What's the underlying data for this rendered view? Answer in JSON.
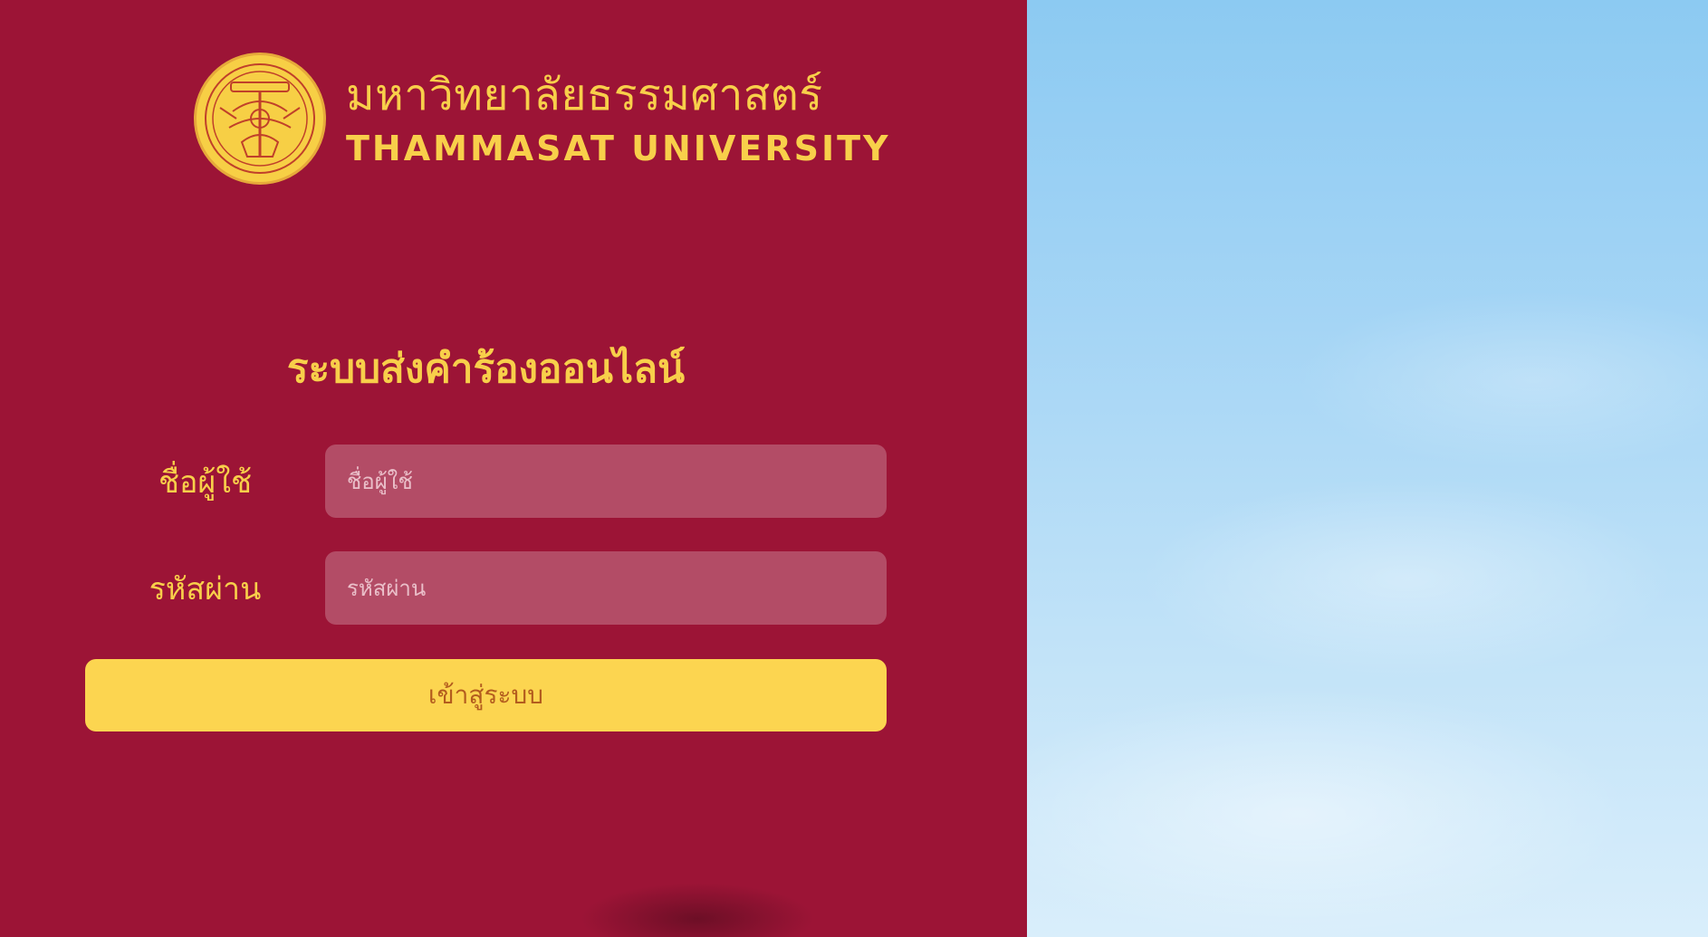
{
  "brand": {
    "name_thai": "มหาวิทยาลัยธรรมศาสตร์",
    "name_en": "THAMMASAT UNIVERSITY",
    "logo_icon": "thammasat-seal",
    "color": "#f8cf4a"
  },
  "system": {
    "title": "ระบบส่งคำร้องออนไลน์"
  },
  "form": {
    "username_label": "ชื่อผู้ใช้",
    "username_placeholder": "ชื่อผู้ใช้",
    "password_label": "รหัสผ่าน",
    "password_placeholder": "รหัสผ่าน",
    "login_button": "เข้าสู่ระบบ"
  },
  "colors": {
    "panel_background": "#9c1436",
    "accent_yellow": "#fcd550",
    "button_text": "#b35c1e",
    "sky": "#a5d5f5"
  }
}
